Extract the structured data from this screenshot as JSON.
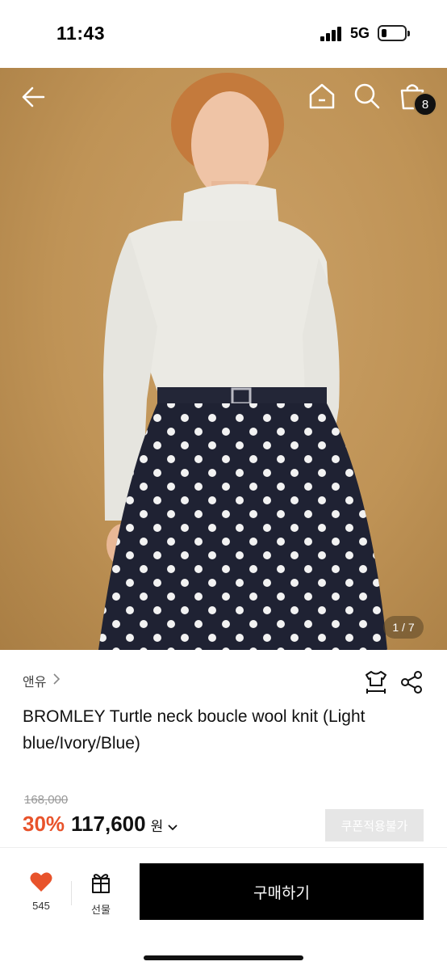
{
  "status_bar": {
    "time": "11:43",
    "network": "5G"
  },
  "header": {
    "cart_count": "8"
  },
  "gallery": {
    "pager": "1 / 7"
  },
  "product": {
    "brand": "앤유",
    "title": "BROMLEY Turtle neck boucle wool knit (Light blue/Ivory/Blue)",
    "original_price": "168,000",
    "discount": "30%",
    "price": "117,600",
    "currency": "원",
    "coupon_label": "쿠폰적용불가"
  },
  "bottom_bar": {
    "like_count": "545",
    "gift_label": "선물",
    "buy_label": "구매하기"
  },
  "colors": {
    "discount": "#e8532b",
    "like": "#e8532b",
    "buy_button": "#000000"
  },
  "icons": [
    "back-arrow-icon",
    "home-icon",
    "search-icon",
    "shopping-bag-icon",
    "size-guide-icon",
    "share-icon",
    "heart-icon",
    "gift-icon",
    "chevron-right-icon",
    "chevron-down-icon"
  ]
}
